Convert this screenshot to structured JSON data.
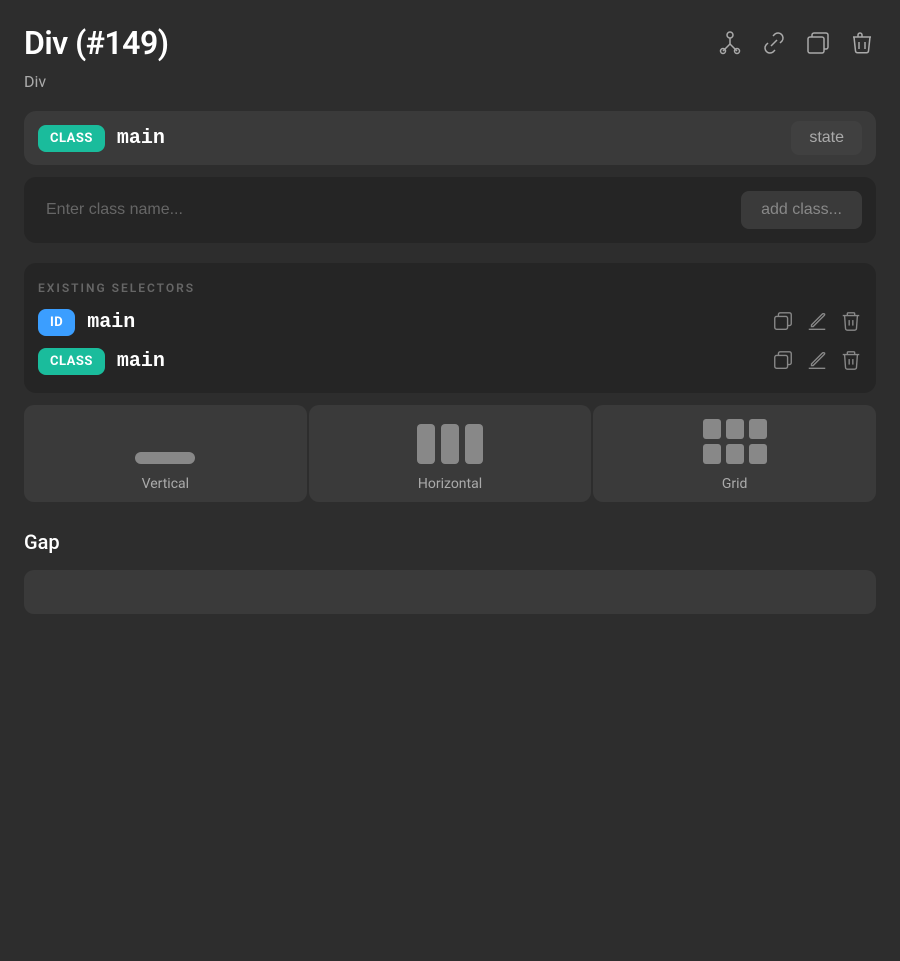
{
  "header": {
    "title": "Div (#149)",
    "subtitle": "Div",
    "icons": {
      "hierarchy": "hierarchy-icon",
      "link": "link-icon",
      "duplicate": "duplicate-icon",
      "delete": "delete-icon"
    }
  },
  "class_row": {
    "badge_label": "CLASS",
    "value": "main",
    "state_button": "state"
  },
  "input_row": {
    "placeholder": "Enter class name...",
    "add_button": "add class..."
  },
  "existing_selectors": {
    "section_label": "EXISTING SELECTORS",
    "items": [
      {
        "type": "ID",
        "badge_label": "ID",
        "value": "main"
      },
      {
        "type": "CLASS",
        "badge_label": "CLASS",
        "value": "main"
      }
    ]
  },
  "layout": {
    "options": [
      {
        "label": "Vertical"
      },
      {
        "label": "Horizontal"
      },
      {
        "label": "Grid"
      }
    ]
  },
  "gap": {
    "title": "Gap"
  }
}
